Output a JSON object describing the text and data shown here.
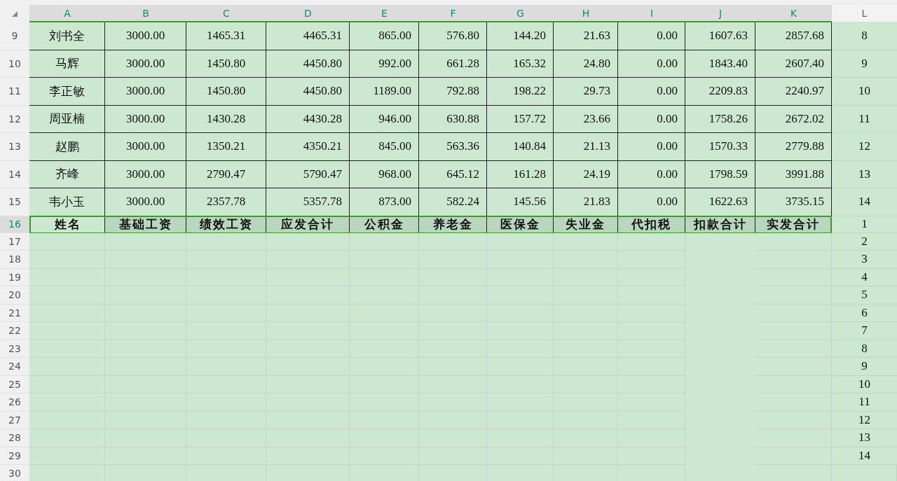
{
  "columns": [
    {
      "label": "A",
      "selected": true
    },
    {
      "label": "B",
      "selected": true
    },
    {
      "label": "C",
      "selected": true
    },
    {
      "label": "D",
      "selected": true
    },
    {
      "label": "E",
      "selected": true
    },
    {
      "label": "F",
      "selected": true
    },
    {
      "label": "G",
      "selected": true
    },
    {
      "label": "H",
      "selected": true
    },
    {
      "label": "I",
      "selected": true
    },
    {
      "label": "J",
      "selected": true
    },
    {
      "label": "K",
      "selected": true
    },
    {
      "label": "L",
      "selected": false
    }
  ],
  "rows": [
    {
      "number": "9",
      "kind": "data",
      "selected": false,
      "cells": [
        "刘书全",
        "3000.00",
        "1465.31",
        "4465.31",
        "865.00",
        "576.80",
        "144.20",
        "21.63",
        "0.00",
        "1607.63",
        "2857.68"
      ],
      "column_l": "8"
    },
    {
      "number": "10",
      "kind": "data",
      "selected": false,
      "cells": [
        "马辉",
        "3000.00",
        "1450.80",
        "4450.80",
        "992.00",
        "661.28",
        "165.32",
        "24.80",
        "0.00",
        "1843.40",
        "2607.40"
      ],
      "column_l": "9"
    },
    {
      "number": "11",
      "kind": "data",
      "selected": false,
      "cells": [
        "李正敏",
        "3000.00",
        "1450.80",
        "4450.80",
        "1189.00",
        "792.88",
        "198.22",
        "29.73",
        "0.00",
        "2209.83",
        "2240.97"
      ],
      "column_l": "10"
    },
    {
      "number": "12",
      "kind": "data",
      "selected": false,
      "cells": [
        "周亚楠",
        "3000.00",
        "1430.28",
        "4430.28",
        "946.00",
        "630.88",
        "157.72",
        "23.66",
        "0.00",
        "1758.26",
        "2672.02"
      ],
      "column_l": "11"
    },
    {
      "number": "13",
      "kind": "data",
      "selected": false,
      "cells": [
        "赵鹏",
        "3000.00",
        "1350.21",
        "4350.21",
        "845.00",
        "563.36",
        "140.84",
        "21.13",
        "0.00",
        "1570.33",
        "2779.88"
      ],
      "column_l": "12"
    },
    {
      "number": "14",
      "kind": "data",
      "selected": false,
      "cells": [
        "齐峰",
        "3000.00",
        "2790.47",
        "5790.47",
        "968.00",
        "645.12",
        "161.28",
        "24.19",
        "0.00",
        "1798.59",
        "3991.88"
      ],
      "column_l": "13"
    },
    {
      "number": "15",
      "kind": "data",
      "selected": false,
      "cells": [
        "韦小玉",
        "3000.00",
        "2357.78",
        "5357.78",
        "873.00",
        "582.24",
        "145.56",
        "21.83",
        "0.00",
        "1622.63",
        "3735.15"
      ],
      "column_l": "14"
    },
    {
      "number": "16",
      "kind": "heading",
      "selected": true,
      "cells": [
        {
          "text": "姓名",
          "active": true
        },
        {
          "text": "基础工资",
          "active": false
        },
        {
          "text": "绩效工资",
          "active": false
        },
        {
          "text": "应发合计",
          "active": false
        },
        {
          "text": "公积金",
          "active": false
        },
        {
          "text": "养老金",
          "active": false
        },
        {
          "text": "医保金",
          "active": false
        },
        {
          "text": "失业金",
          "active": false
        },
        {
          "text": "代扣税",
          "active": false
        },
        {
          "text": "扣款合计",
          "active": false
        },
        {
          "text": "实发合计",
          "active": false
        }
      ],
      "column_l": "1"
    },
    {
      "number": "17",
      "kind": "blank",
      "selected": false,
      "column_l": "2"
    },
    {
      "number": "18",
      "kind": "blank",
      "selected": false,
      "column_l": "3"
    },
    {
      "number": "19",
      "kind": "blank",
      "selected": false,
      "column_l": "4"
    },
    {
      "number": "20",
      "kind": "blank",
      "selected": false,
      "column_l": "5"
    },
    {
      "number": "21",
      "kind": "blank",
      "selected": false,
      "column_l": "6"
    },
    {
      "number": "22",
      "kind": "blank",
      "selected": false,
      "column_l": "7"
    },
    {
      "number": "23",
      "kind": "blank",
      "selected": false,
      "column_l": "8"
    },
    {
      "number": "24",
      "kind": "blank",
      "selected": false,
      "column_l": "9"
    },
    {
      "number": "25",
      "kind": "blank",
      "selected": false,
      "column_l": "10"
    },
    {
      "number": "26",
      "kind": "blank",
      "selected": false,
      "column_l": "11"
    },
    {
      "number": "27",
      "kind": "blank",
      "selected": false,
      "column_l": "12"
    },
    {
      "number": "28",
      "kind": "blank",
      "selected": false,
      "column_l": "13"
    },
    {
      "number": "29",
      "kind": "blank",
      "selected": false,
      "column_l": "14"
    },
    {
      "number": "30",
      "kind": "blank",
      "selected": false
    }
  ]
}
